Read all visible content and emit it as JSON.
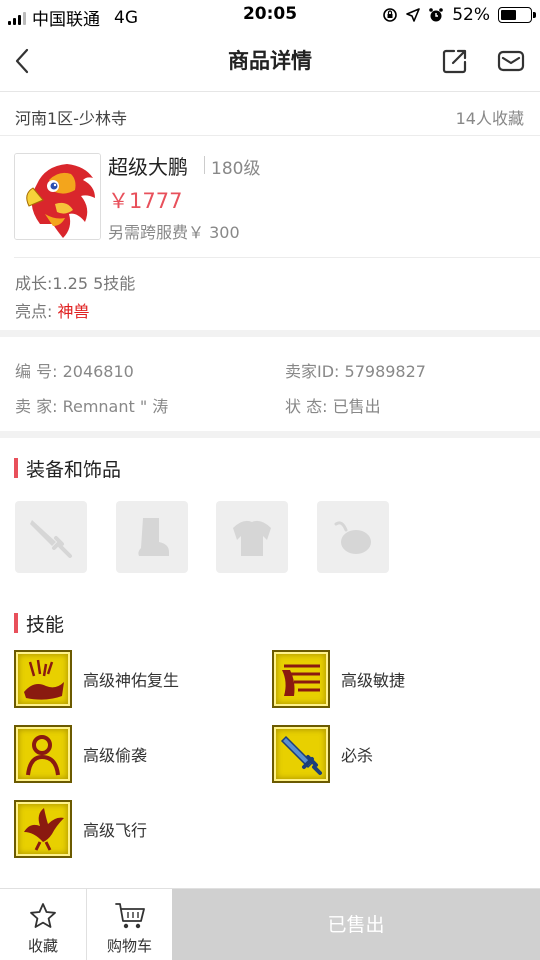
{
  "status_bar": {
    "carrier": "中国联通",
    "network": "4G",
    "time": "20:05",
    "battery": "52%",
    "battery_level": 0.52
  },
  "nav": {
    "title": "商品详情",
    "icons": [
      "back-arrow-icon",
      "share-icon",
      "mail-icon"
    ]
  },
  "listing": {
    "server": "河南1区-少林寺",
    "favorites": "14人收藏"
  },
  "product": {
    "name": "超级大鹏",
    "level": "180级",
    "price": "￥1777",
    "fee": "另需跨服费￥ 300",
    "growth": "成长:1.25 5技能",
    "highlight_label": "亮点: ",
    "highlight_value": "神兽"
  },
  "info": {
    "id_label": "编 号: ",
    "id_value": "2046810",
    "seller_id_label": "卖家ID: ",
    "seller_id_value": "57989827",
    "seller_label": "卖 家: ",
    "seller_value": "Remnant \" 涛",
    "state_label": "状 态: ",
    "state_value": "已售出"
  },
  "sections": {
    "equipment_title": "装备和饰品",
    "skills_title": "技能"
  },
  "equipment_slots": [
    "weapon-slot-icon",
    "boots-slot-icon",
    "armor-slot-icon",
    "accessory-slot-icon"
  ],
  "skills": [
    {
      "name": "高级神佑复生",
      "icon": "revive-skill-icon"
    },
    {
      "name": "高级敏捷",
      "icon": "agility-skill-icon"
    },
    {
      "name": "高级偷袭",
      "icon": "sneak-attack-skill-icon"
    },
    {
      "name": "必杀",
      "icon": "critical-skill-icon"
    },
    {
      "name": "高级飞行",
      "icon": "flight-skill-icon"
    }
  ],
  "bottom_bar": {
    "favorite_label": "收藏",
    "cart_label": "购物车",
    "sold_label": "已售出"
  },
  "colors": {
    "accent": "#e8505b",
    "highlight_red": "#e02020",
    "skill_gold": "#e8d000"
  }
}
